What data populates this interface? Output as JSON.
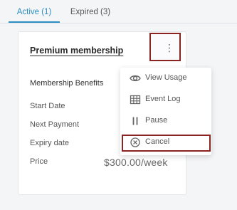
{
  "tabs": [
    {
      "label": "Active (1)"
    },
    {
      "label": "Expired (3)"
    }
  ],
  "membership": {
    "title": "Premium membership",
    "rows": {
      "benefits": "Membership Benefits",
      "start_date": "Start Date",
      "next_payment": "Next Payment",
      "expiry_date": "Expiry date",
      "price_label": "Price",
      "price_value": "$300.00/week"
    }
  },
  "kebab": {
    "glyph": "⋮",
    "icon": "more-vertical-icon"
  },
  "menu": {
    "items": [
      {
        "label": "View Usage",
        "icon": "eye-icon"
      },
      {
        "label": "Event Log",
        "icon": "table-icon"
      },
      {
        "label": "Pause",
        "icon": "pause-icon"
      },
      {
        "label": "Cancel",
        "icon": "cancel-circle-icon"
      }
    ]
  },
  "colors": {
    "accent": "#2d8ec1",
    "highlight_border": "#8b2323",
    "icon": "#666666"
  }
}
